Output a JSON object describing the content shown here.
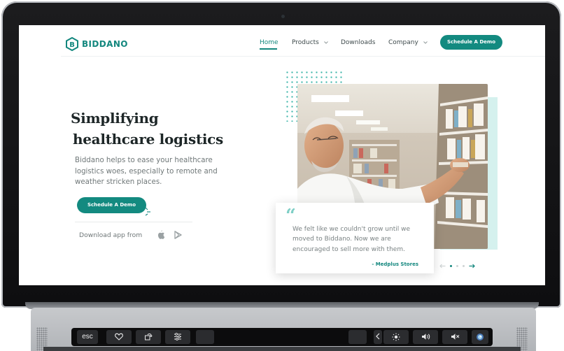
{
  "site": {
    "brand": "BIDDANO",
    "nav": {
      "items": [
        {
          "label": "Home",
          "active": true
        },
        {
          "label": "Products",
          "dropdown": true
        },
        {
          "label": "Downloads"
        },
        {
          "label": "Company",
          "dropdown": true
        }
      ],
      "cta_label": "Schedule A Demo"
    },
    "hero": {
      "title_line1": "Simplifying",
      "title_line2": "healthcare logistics",
      "description": "Biddano helps to ease your healthcare logistics woes, especially to remote and weather stricken places.",
      "cta_label": "Schedule A Demo",
      "download_label": "Download app from",
      "download_icons": [
        "apple-icon",
        "google-play-icon"
      ]
    },
    "testimonial": {
      "quote": "We felt like we couldn't grow until we moved to Biddano. Now we are encouraged to sell more with them.",
      "author": "- Medplus Stores",
      "slides": 3,
      "active_slide": 1
    }
  },
  "touchbar": {
    "keys": [
      "esc",
      "favorites-icon",
      "rotate-icon",
      "sliders-icon",
      "blank-key",
      "blank-key",
      "chevron-left-icon",
      "brightness-icon",
      "volume-icon",
      "mute-icon",
      "siri-icon"
    ],
    "esc_label": "esc"
  },
  "colors": {
    "brand_teal": "#13877e",
    "accent_mint": "#d5f1ee",
    "text_dark": "#1d2627",
    "text_muted": "#6f7778"
  }
}
